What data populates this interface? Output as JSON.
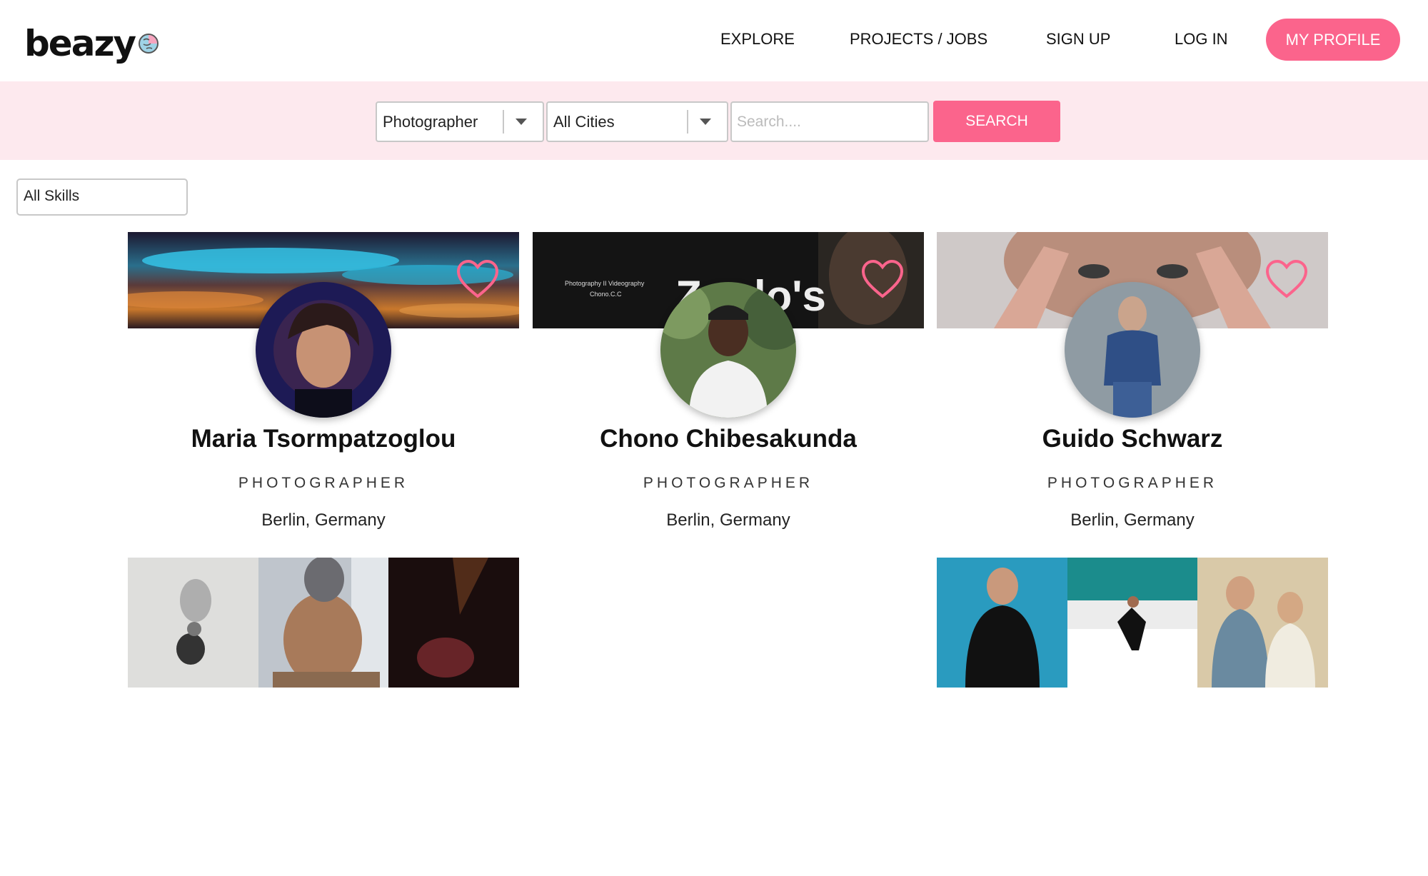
{
  "brand": {
    "name": "beazy"
  },
  "nav": {
    "explore": "EXPLORE",
    "projects": "PROJECTS / JOBS",
    "signup": "SIGN UP",
    "login": "LOG IN",
    "profile": "MY PROFILE"
  },
  "filters": {
    "category": "Photographer",
    "city": "All Cities",
    "search_placeholder": "Search....",
    "search_button": "SEARCH",
    "skills": "All Skills"
  },
  "colors": {
    "accent": "#fb648c",
    "filter_bg": "#fde9ee"
  },
  "profiles": [
    {
      "name": "Maria Tsormpatzoglou",
      "role": "PHOTOGRAPHER",
      "city": "Berlin, Germany",
      "favorite_icon": "heart-outline-icon"
    },
    {
      "name": "Chono Chibesakunda",
      "role": "PHOTOGRAPHER",
      "city": "Berlin, Germany",
      "favorite_icon": "heart-outline-icon",
      "cover_text": [
        "Photography II Videography",
        "Chono.C.C",
        "Zoolo's"
      ]
    },
    {
      "name": "Guido Schwarz",
      "role": "PHOTOGRAPHER",
      "city": "Berlin, Germany",
      "favorite_icon": "heart-outline-icon"
    }
  ]
}
